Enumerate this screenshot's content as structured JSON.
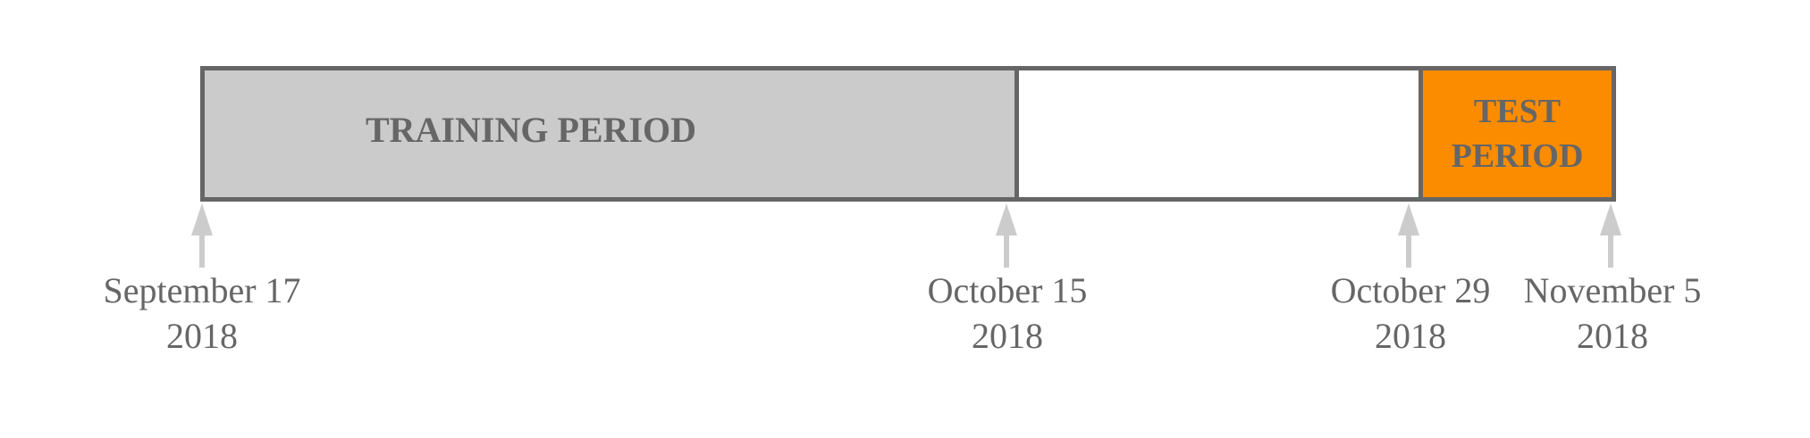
{
  "periods": {
    "training": "TRAINING PERIOD",
    "gap": "",
    "test": "TEST\nPERIOD"
  },
  "dates": [
    {
      "month_day": "September 17",
      "year": "2018"
    },
    {
      "month_day": "October 15",
      "year": "2018"
    },
    {
      "month_day": "October 29",
      "year": "2018"
    },
    {
      "month_day": "November 5",
      "year": "2018"
    }
  ],
  "colors": {
    "training_fill": "#cbcbcb",
    "gap_fill": "#ffffff",
    "test_fill": "#fb8c00",
    "border": "#666666",
    "arrow": "#cccccc",
    "text": "#666666"
  }
}
